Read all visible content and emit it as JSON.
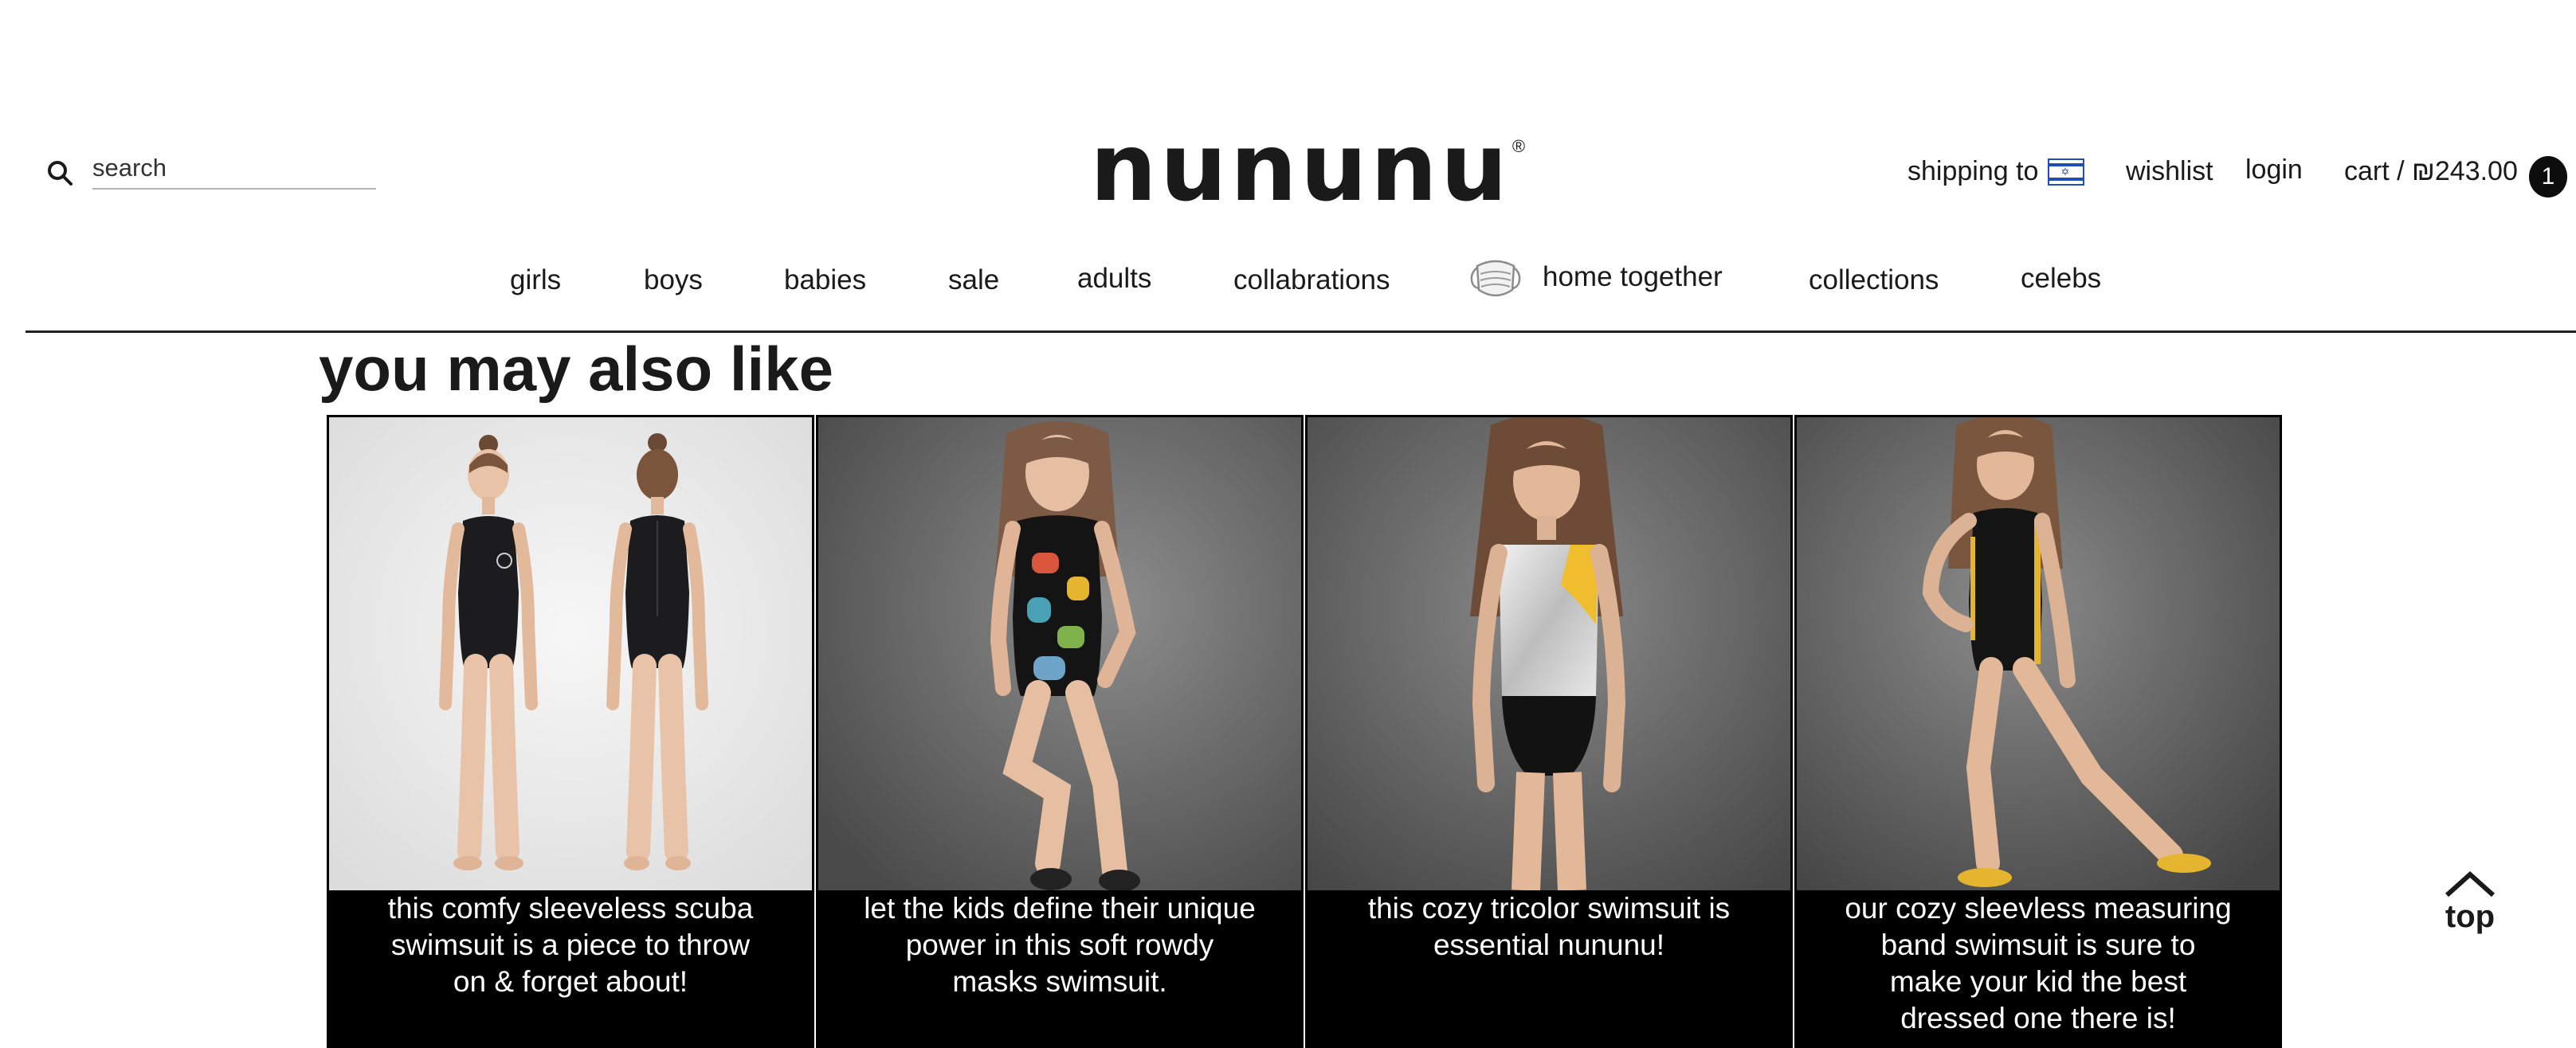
{
  "header": {
    "search_placeholder": "search",
    "logo_text": "nununu",
    "logo_mark": "®",
    "shipping_label": "shipping to",
    "wishlist_label": "wishlist",
    "login_label": "login",
    "cart_label": "cart / ₪243.00",
    "cart_count": "1"
  },
  "nav": {
    "items": [
      "girls",
      "boys",
      "babies",
      "sale",
      "adults",
      "collabrations",
      "home together",
      "collections",
      "celebs"
    ]
  },
  "recommendations": {
    "title": "you may also like",
    "products": [
      {
        "caption": "this comfy sleeveless scuba swimsuit is a piece to throw on & forget about!"
      },
      {
        "caption": "let the kids define their unique power in this soft rowdy masks swimsuit."
      },
      {
        "caption": "this cozy tricolor swimsuit is essential nununu!"
      },
      {
        "caption": "our cozy sleevless measuring band swimsuit is sure to make your kid the best dressed one there is!"
      }
    ]
  },
  "top_button": {
    "label": "top"
  },
  "icons": {
    "search": "search-icon",
    "flag": "israel-flag-icon",
    "mask": "face-mask-icon",
    "top": "chevron-up-icon"
  }
}
